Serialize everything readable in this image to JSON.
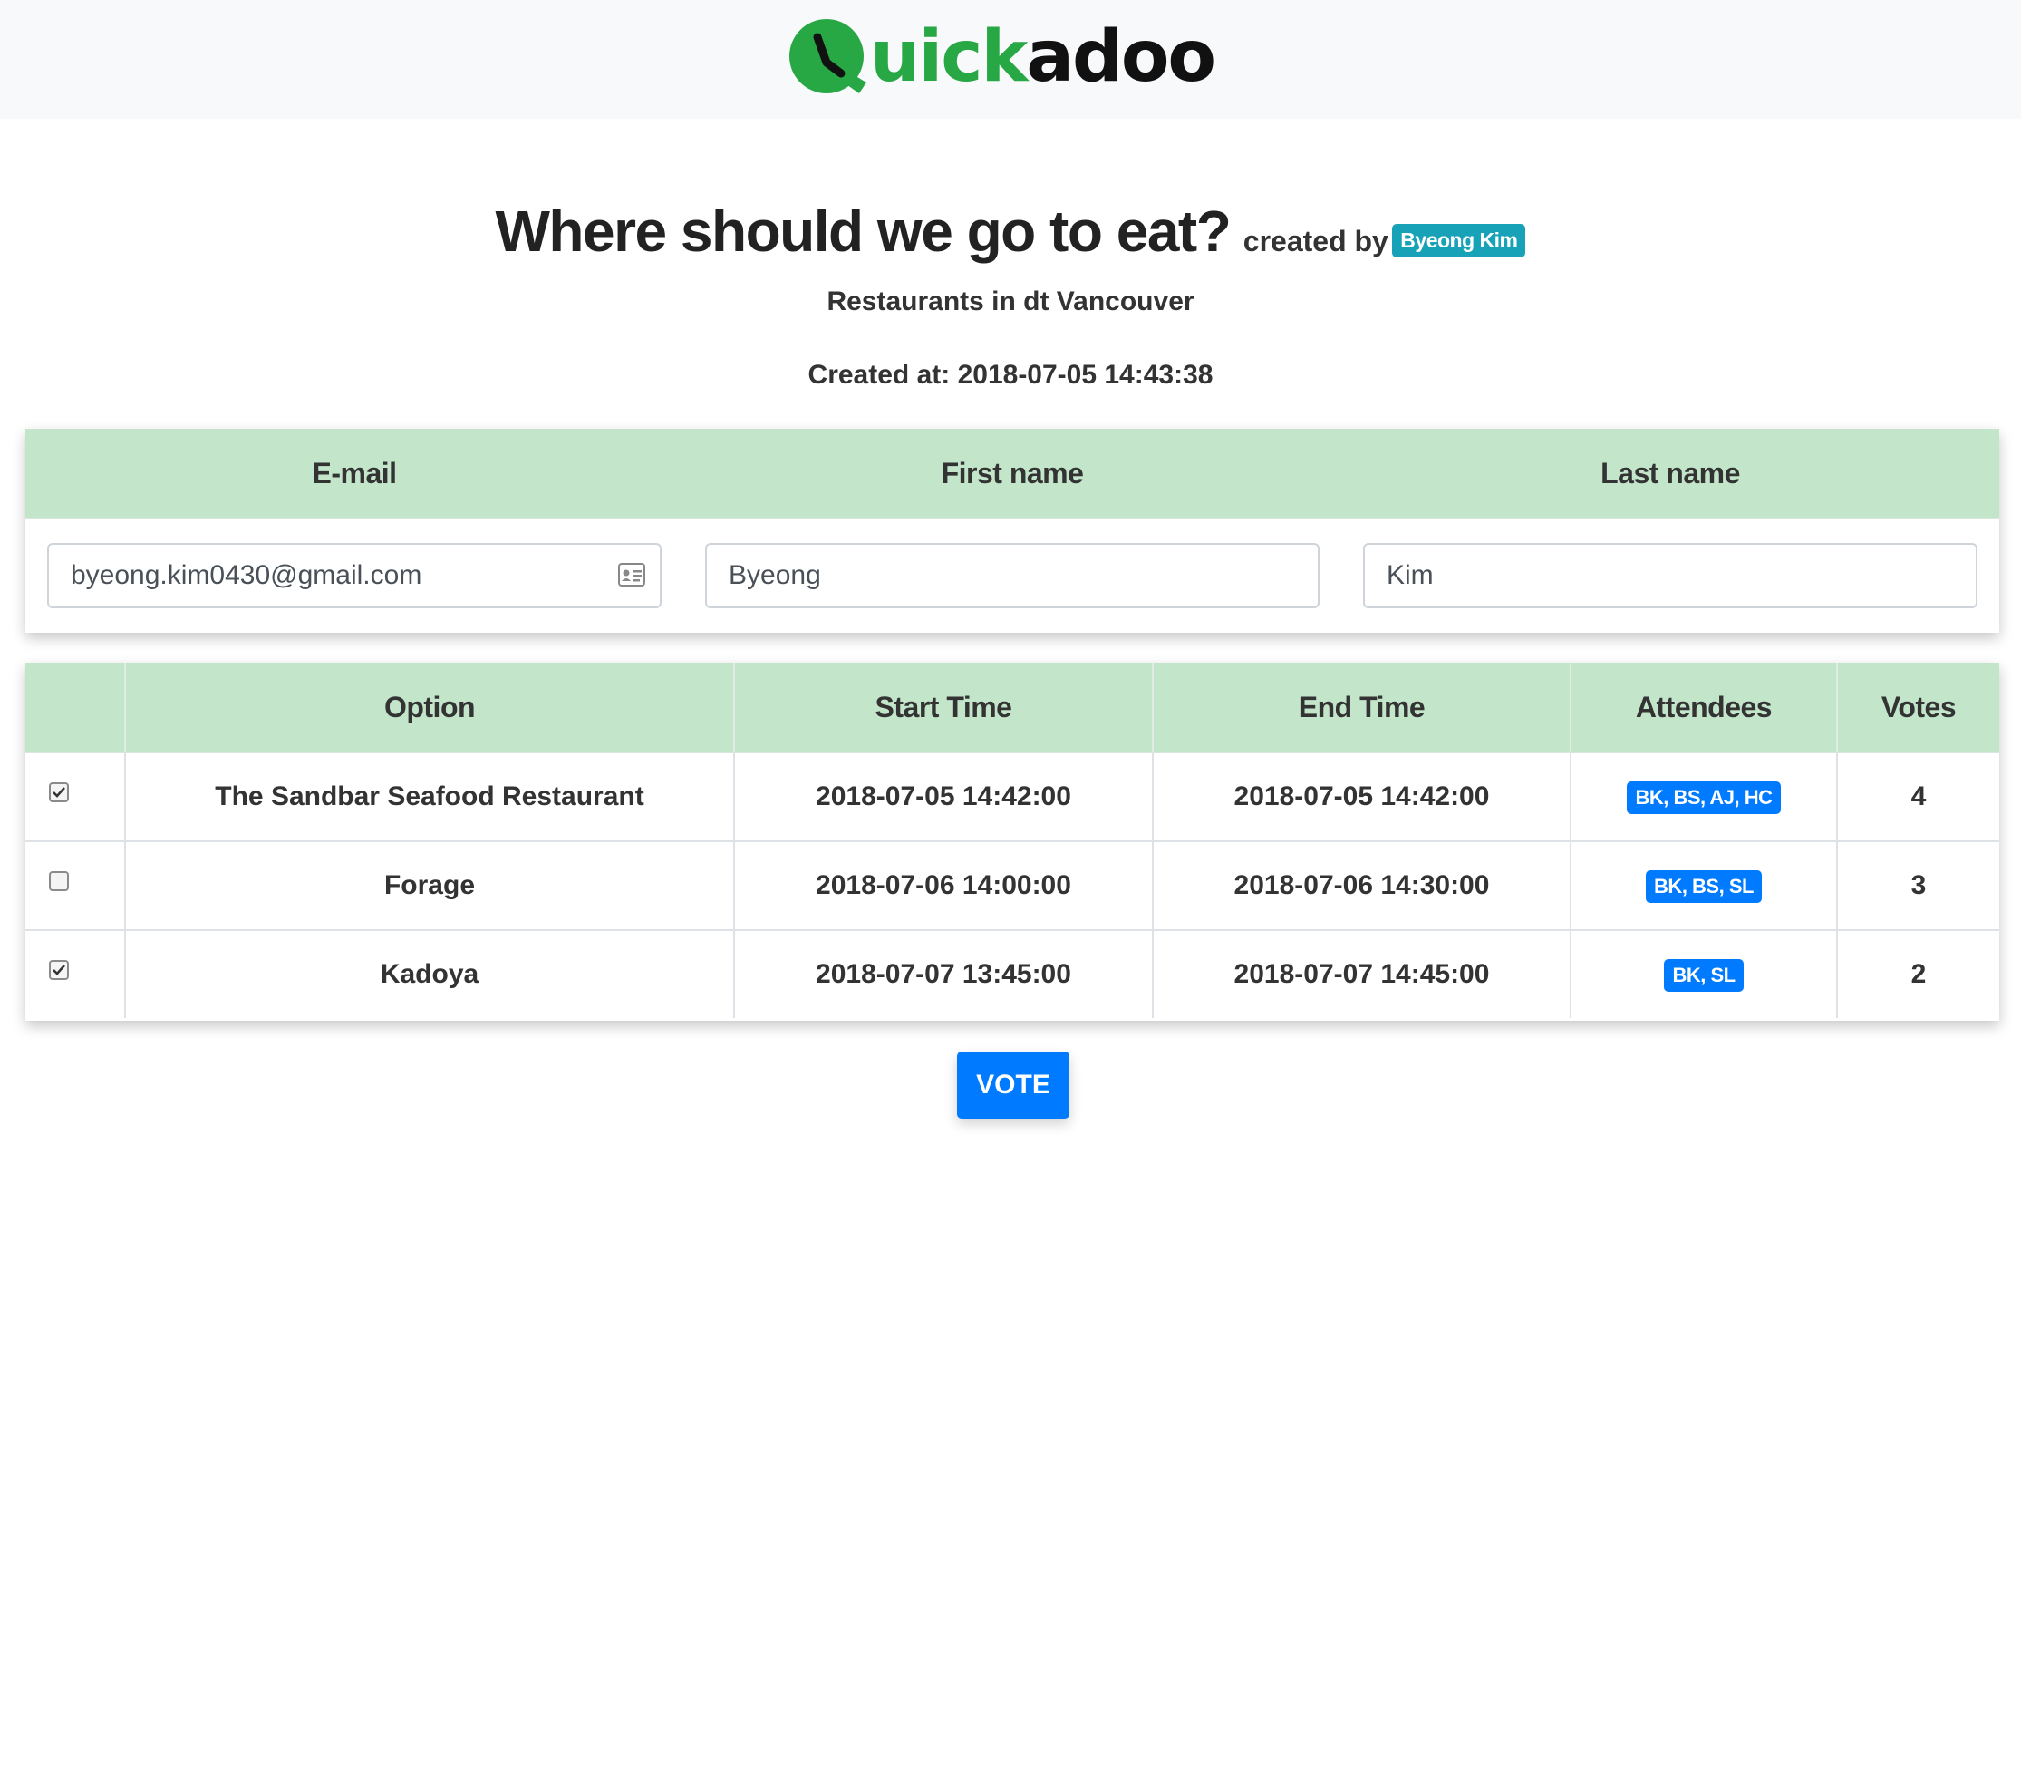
{
  "brand": {
    "logo_green_text": "uick",
    "logo_black_text": "adoo",
    "icon": "clock-q-icon",
    "colors": {
      "green": "#28a745",
      "black": "#111111"
    }
  },
  "poll": {
    "title": "Where should we go to eat?",
    "created_by_label": "created by",
    "creator": "Byeong Kim",
    "description": "Restaurants in dt Vancouver",
    "created_at": "Created at: 2018-07-05 14:43:38"
  },
  "user_form": {
    "headers": {
      "email": "E-mail",
      "first_name": "First name",
      "last_name": "Last name"
    },
    "email": "byeong.kim0430@gmail.com",
    "first_name": "Byeong",
    "last_name": "Kim",
    "email_icon": "contact-card-icon"
  },
  "options_table": {
    "headers": {
      "option": "Option",
      "start": "Start Time",
      "end": "End Time",
      "attendees": "Attendees",
      "votes": "Votes"
    },
    "rows": [
      {
        "checked": true,
        "option": "The Sandbar Seafood Restaurant",
        "start": "2018-07-05 14:42:00",
        "end": "2018-07-05 14:42:00",
        "attendees": "BK, BS, AJ, HC",
        "votes": "4"
      },
      {
        "checked": false,
        "option": "Forage",
        "start": "2018-07-06 14:00:00",
        "end": "2018-07-06 14:30:00",
        "attendees": "BK, BS, SL",
        "votes": "3"
      },
      {
        "checked": true,
        "option": "Kadoya",
        "start": "2018-07-07 13:45:00",
        "end": "2018-07-07 14:45:00",
        "attendees": "BK, SL",
        "votes": "2"
      }
    ]
  },
  "actions": {
    "vote_label": "VOTE"
  },
  "colors": {
    "header_green": "#c3e6cb",
    "primary": "#007bff",
    "info": "#17a2b8"
  }
}
